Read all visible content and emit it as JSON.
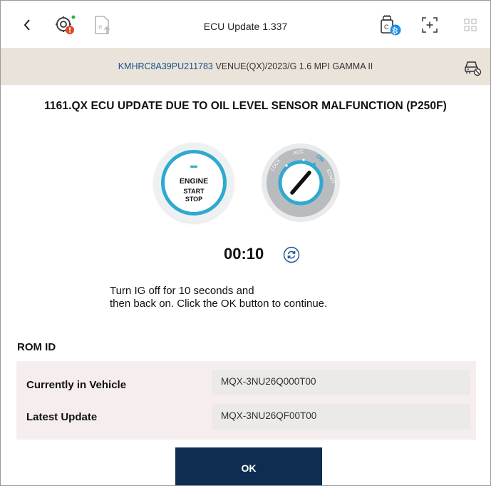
{
  "header": {
    "title": "ECU Update 1.337",
    "icons": [
      "back-icon",
      "diagnosis-icon",
      "e-update-icon",
      "vci-bluetooth-icon",
      "scan-icon",
      "grid-icon"
    ]
  },
  "vehicle": {
    "vin": "KMHRC8A39PU211783",
    "info": "VENUE(QX)/2023/G 1.6 MPI GAMMA II"
  },
  "heading": "1161.QX ECU UPDATE DUE TO OIL LEVEL SENSOR MALFUNCTION (P250F)",
  "engine_button": {
    "line1": "ENGINE",
    "line2": "START",
    "line3": "STOP"
  },
  "ignition": {
    "positions": [
      "LOCK",
      "ACC",
      "ON",
      "START"
    ],
    "active": "ON"
  },
  "timer": "00:10",
  "instruction": {
    "line1": "Turn IG off for 10 seconds and",
    "line2": "then back on. Click the OK button to continue."
  },
  "rom": {
    "title": "ROM ID",
    "rows": [
      {
        "label": "Currently in Vehicle",
        "value": "MQX-3NU26Q000T00"
      },
      {
        "label": "Latest Update",
        "value": "MQX-3NU26QF00T00"
      }
    ]
  },
  "ok_label": "OK",
  "colors": {
    "accent": "#2fa9d0",
    "primary_button": "#0f2d52",
    "vehicle_bar": "#e9e3da",
    "alert": "#e0472b"
  }
}
